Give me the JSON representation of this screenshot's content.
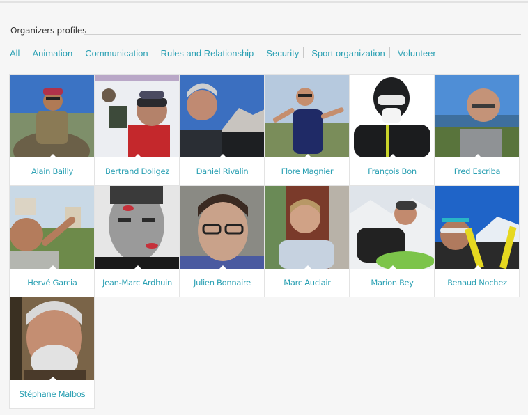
{
  "section": {
    "title": "Organizers profiles"
  },
  "filters": [
    {
      "label": "All"
    },
    {
      "label": "Animation"
    },
    {
      "label": "Communication"
    },
    {
      "label": "Rules and Relationship"
    },
    {
      "label": "Security"
    },
    {
      "label": "Sport organization"
    },
    {
      "label": "Volunteer"
    }
  ],
  "profiles": [
    {
      "name": "Alain Bailly"
    },
    {
      "name": "Bertrand Doligez"
    },
    {
      "name": "Daniel Rivalin"
    },
    {
      "name": "Flore Magnier"
    },
    {
      "name": "François Bon"
    },
    {
      "name": "Fred Escriba"
    },
    {
      "name": "Hervé Garcia"
    },
    {
      "name": "Jean-Marc Ardhuin"
    },
    {
      "name": "Julien Bonnaire"
    },
    {
      "name": "Marc Auclair"
    },
    {
      "name": "Marion Rey"
    },
    {
      "name": "Renaud Nochez"
    },
    {
      "name": "Stéphane Malbos"
    }
  ],
  "colors": {
    "accent": "#2aa0b3",
    "background": "#f6f6f6",
    "card": "#ffffff"
  }
}
